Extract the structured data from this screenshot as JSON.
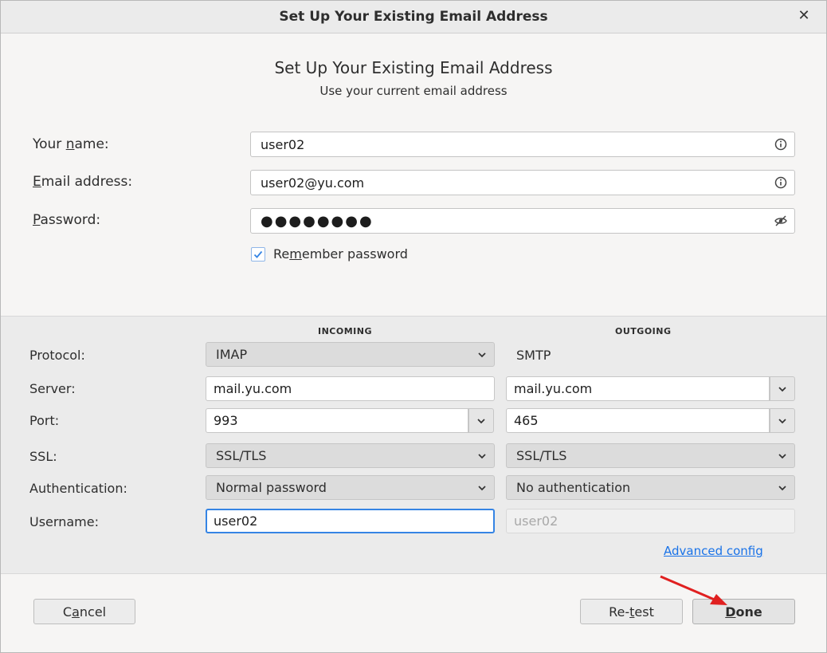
{
  "window": {
    "title": "Set Up Your Existing Email Address",
    "close_glyph": "✕"
  },
  "header": {
    "title": "Set Up Your Existing Email Address",
    "subtitle": "Use your current email address"
  },
  "identity": {
    "name_label": {
      "pre": "Your ",
      "accel": "n",
      "post": "ame:"
    },
    "name_value": "user02",
    "email_label": {
      "pre": "",
      "accel": "E",
      "post": "mail address:"
    },
    "email_value": "user02@yu.com",
    "password_label": {
      "pre": "",
      "accel": "P",
      "post": "assword:"
    },
    "password_masked": "●●●●●●●●",
    "remember": {
      "pre": "Re",
      "accel": "m",
      "post": "ember password",
      "checked": true
    }
  },
  "server_settings": {
    "incoming_header": "INCOMING",
    "outgoing_header": "OUTGOING",
    "labels": {
      "protocol": "Protocol:",
      "server": "Server:",
      "port": "Port:",
      "ssl": "SSL:",
      "authentication": "Authentication:",
      "username": "Username:"
    },
    "incoming": {
      "protocol": "IMAP",
      "server": "mail.yu.com",
      "port": "993",
      "ssl": "SSL/TLS",
      "authentication": "Normal password",
      "username": "user02"
    },
    "outgoing": {
      "protocol": "SMTP",
      "server": "mail.yu.com",
      "port": "465",
      "ssl": "SSL/TLS",
      "authentication": "No authentication",
      "username": "user02"
    },
    "advanced_link": "Advanced config"
  },
  "footer": {
    "cancel": {
      "pre": "C",
      "accel": "a",
      "post": "ncel"
    },
    "retest": {
      "pre": "Re-",
      "accel": "t",
      "post": "est"
    },
    "done": {
      "pre": "",
      "accel": "D",
      "post": "one"
    }
  },
  "colors": {
    "accent": "#3584e4",
    "link": "#1a73e8",
    "annotation_arrow": "#e02020"
  },
  "icons": [
    "close-icon",
    "info-icon",
    "eye-slash-icon",
    "checkmark-icon",
    "chevron-down-icon",
    "red-arrow-annotation"
  ]
}
